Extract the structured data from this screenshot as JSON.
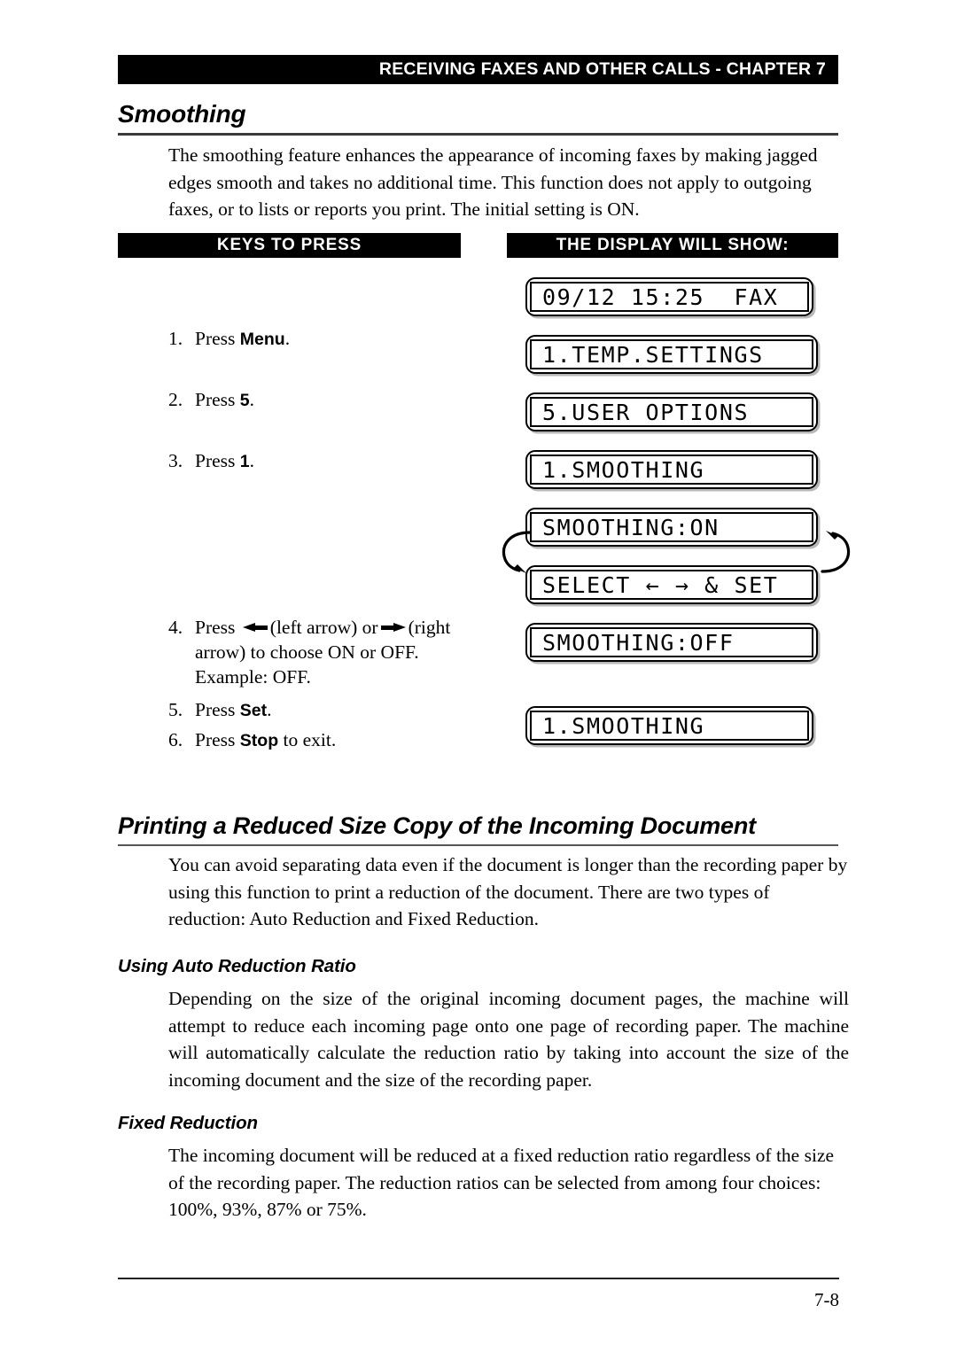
{
  "header": {
    "chapter_bar": "RECEIVING FAXES AND OTHER CALLS - CHAPTER 7"
  },
  "sections": {
    "smoothing": {
      "heading": "Smoothing",
      "body": "The smoothing feature enhances the appearance of incoming faxes by making jagged edges smooth and takes no additional time. This function does not apply to outgoing faxes, or to lists or reports you print. The initial setting is ON."
    },
    "reduced_copy": {
      "heading": "Printing a Reduced Size Copy of the Incoming Document",
      "body": "You can avoid separating data even if the document is longer than the recording paper by using this function to print a reduction of the document. There are two types of reduction: Auto Reduction and Fixed Reduction."
    },
    "auto_reduction": {
      "heading": "Using Auto Reduction Ratio",
      "body": "Depending on the size of the original incoming document pages, the machine will attempt to reduce each incoming page onto one page of recording paper.  The machine will automatically calculate the reduction ratio by taking into account the size of the incoming document and the size of the recording paper."
    },
    "fixed_reduction": {
      "heading": "Fixed Reduction",
      "body": "The incoming document will be reduced at a fixed reduction ratio regardless of the size of the recording paper. The reduction ratios can be selected from among four choices: 100%, 93%, 87% or 75%."
    }
  },
  "procedure": {
    "column_headers": {
      "keys": "KEYS TO PRESS",
      "display": "THE DISPLAY WILL SHOW:"
    },
    "steps": [
      {
        "num": "1.",
        "pre": "Press ",
        "key": "Menu",
        "post": "."
      },
      {
        "num": "2.",
        "pre": "Press ",
        "key": "5",
        "post": "."
      },
      {
        "num": "3.",
        "pre": "Press ",
        "key": "1",
        "post": "."
      },
      {
        "num": "4.",
        "pre": "Press ",
        "left_arrow_label": "(left arrow) or",
        "right_arrow_label": "(right arrow) to choose ON or OFF. Example: OFF."
      },
      {
        "num": "5.",
        "pre": "Press ",
        "key": "Set",
        "post": "."
      },
      {
        "num": "6.",
        "pre": "Press ",
        "key": "Stop",
        "post": " to exit."
      }
    ],
    "displays": [
      {
        "text": "09/12 15:25  FAX"
      },
      {
        "text": "1.TEMP.SETTINGS"
      },
      {
        "text": "5.USER OPTIONS"
      },
      {
        "text": "1.SMOOTHING"
      },
      {
        "text": "SMOOTHING:ON"
      },
      {
        "text": "SELECT ← → & SET"
      },
      {
        "text": "SMOOTHING:OFF"
      },
      {
        "text": "1.SMOOTHING"
      }
    ]
  },
  "footer": {
    "page_number": "7-8"
  }
}
